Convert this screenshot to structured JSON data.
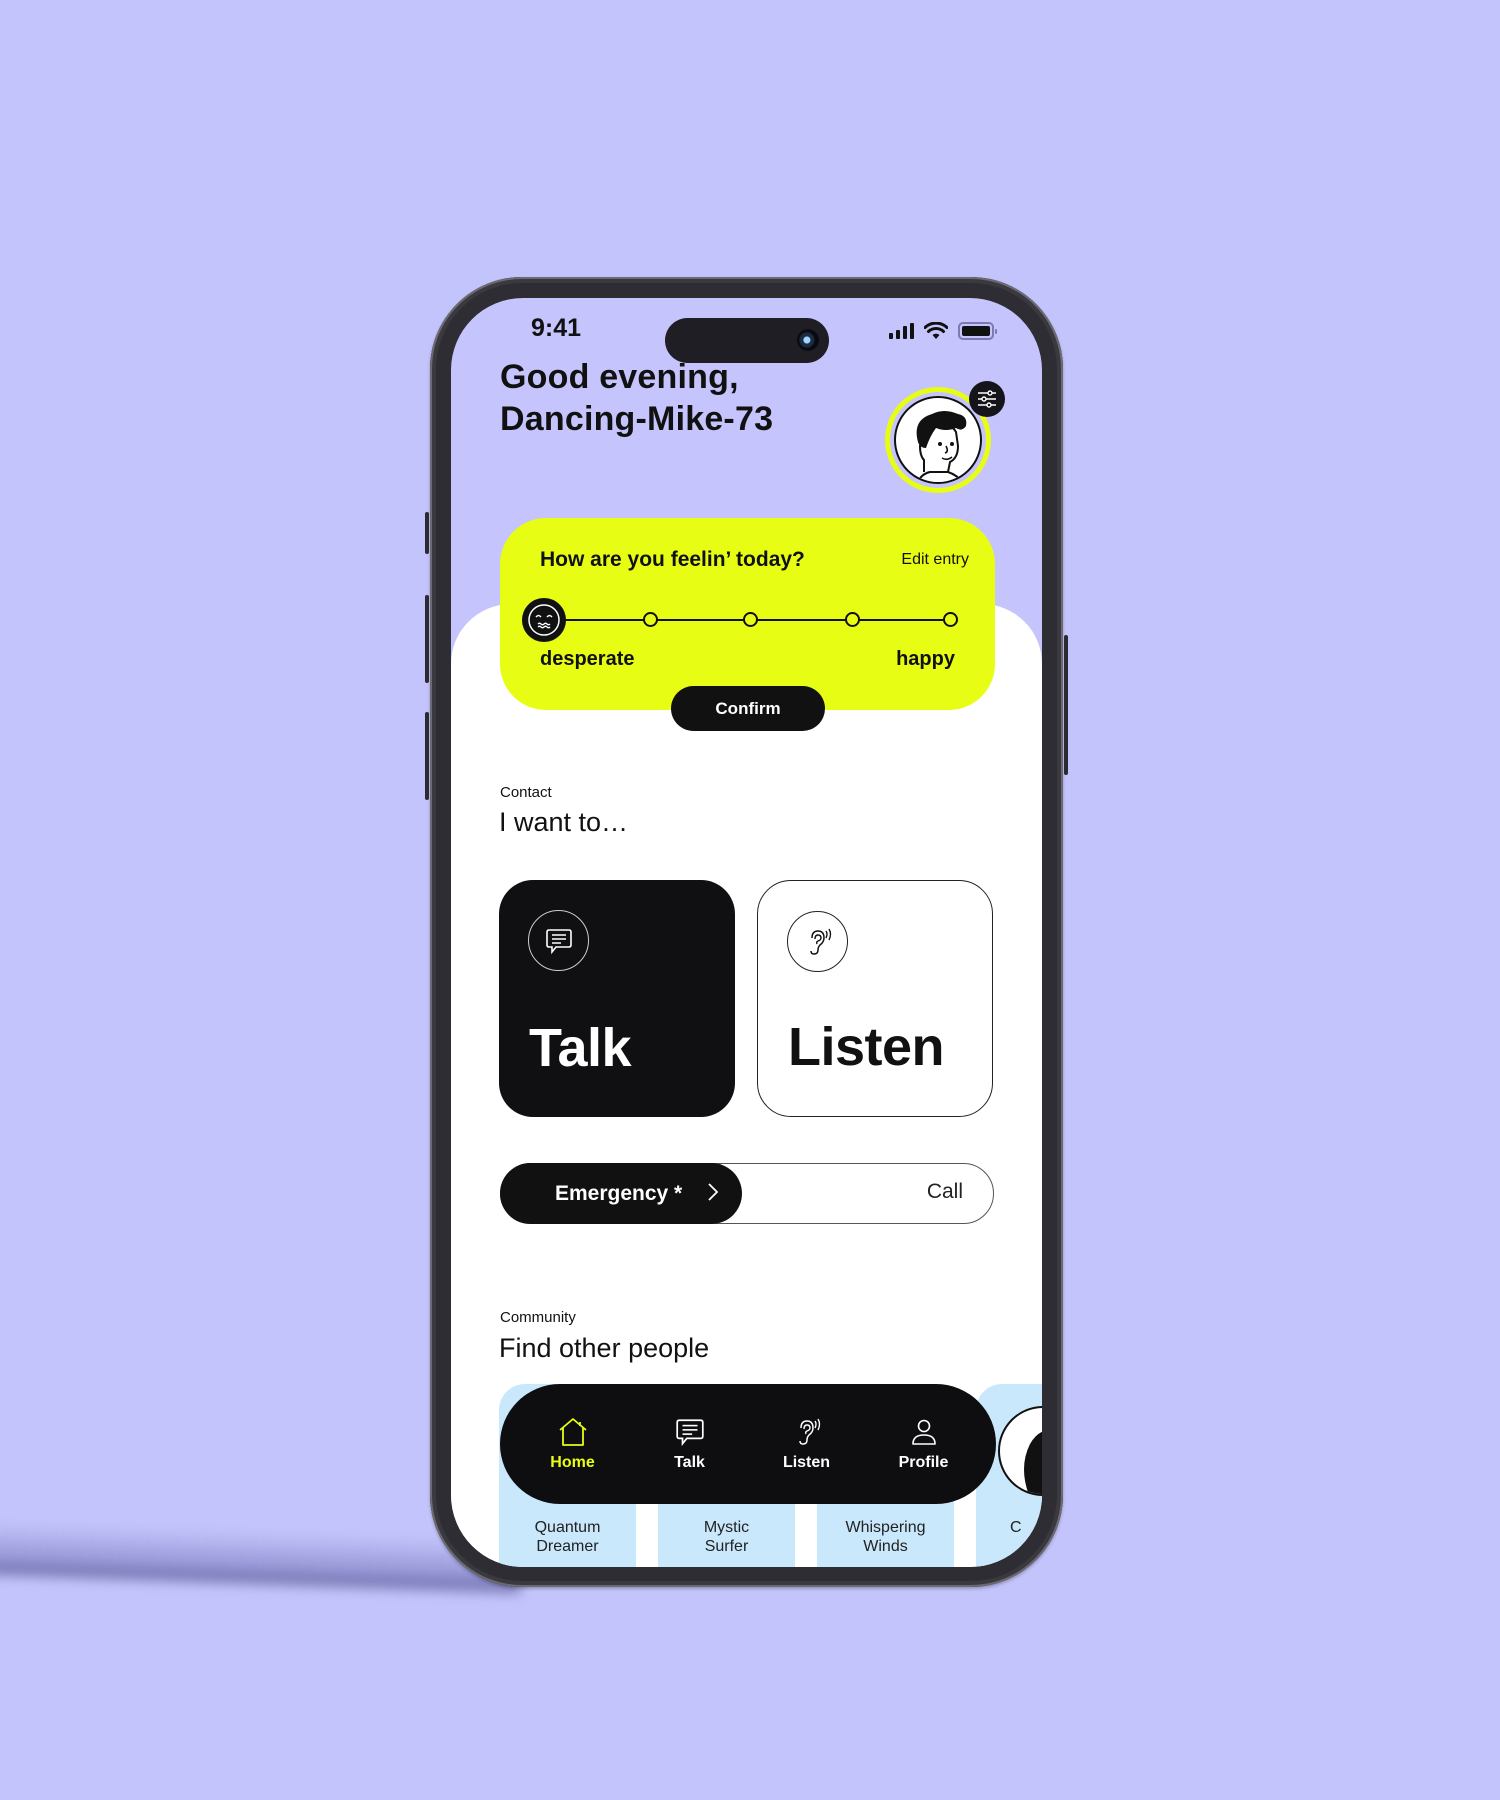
{
  "status_bar": {
    "time": "9:41"
  },
  "header": {
    "greeting_line1": "Good evening,",
    "greeting_line2": "Dancing-Mike-73",
    "avatar_icon": "user-avatar-illustration",
    "settings_icon": "sliders-icon"
  },
  "mood": {
    "question": "How are you feelin’ today?",
    "edit_label": "Edit entry",
    "low_label": "desperate",
    "high_label": "happy",
    "steps": 5,
    "selected_step": 1,
    "confirm_label": "Confirm"
  },
  "contact": {
    "section_label": "Contact",
    "title": "I want to…",
    "talk": {
      "label": "Talk",
      "icon": "chat-bubble-icon"
    },
    "listen": {
      "label": "Listen",
      "icon": "ear-icon"
    }
  },
  "emergency": {
    "label": "Emergency *",
    "action_label": "Call"
  },
  "community": {
    "section_label": "Community",
    "title": "Find other people",
    "people": [
      {
        "name": "Quantum\nDreamer"
      },
      {
        "name": "Mystic\nSurfer"
      },
      {
        "name": "Whispering\nWinds"
      },
      {
        "name": "C"
      }
    ]
  },
  "nav": {
    "items": [
      {
        "label": "Home",
        "icon": "home-icon",
        "active": true
      },
      {
        "label": "Talk",
        "icon": "chat-bubble-icon",
        "active": false
      },
      {
        "label": "Listen",
        "icon": "ear-icon",
        "active": false
      },
      {
        "label": "Profile",
        "icon": "person-icon",
        "active": false
      }
    ]
  },
  "colors": {
    "background": "#c4c4fc",
    "accent": "#e8fd14",
    "dark": "#111111",
    "card_blue": "#c9e8fb"
  }
}
